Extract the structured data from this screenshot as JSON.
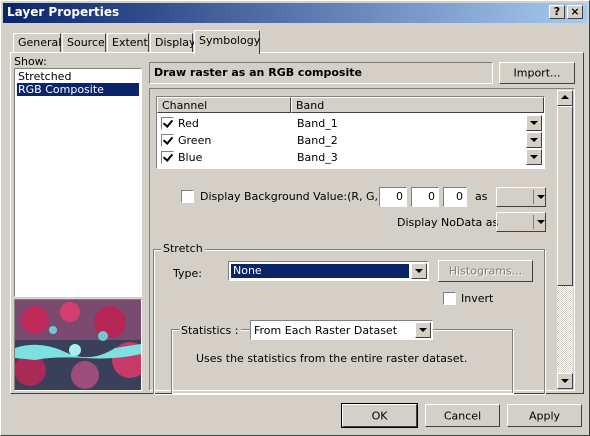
{
  "window": {
    "title": "Layer Properties",
    "help_label": "?",
    "close_label": "×"
  },
  "tabs": [
    {
      "label": "General"
    },
    {
      "label": "Source"
    },
    {
      "label": "Extent"
    },
    {
      "label": "Display"
    },
    {
      "label": "Symbology"
    }
  ],
  "show": {
    "label": "Show:",
    "items": [
      {
        "label": "Stretched"
      },
      {
        "label": "RGB Composite"
      }
    ],
    "selected_index": 1
  },
  "header": {
    "title": "Draw raster as an RGB composite",
    "import_label": "Import..."
  },
  "channel_table": {
    "col_channel": "Channel",
    "col_band": "Band",
    "rows": [
      {
        "channel": "Red",
        "band": "Band_1",
        "checked": true
      },
      {
        "channel": "Green",
        "band": "Band_2",
        "checked": true
      },
      {
        "channel": "Blue",
        "band": "Band_3",
        "checked": true
      }
    ]
  },
  "background": {
    "label": "Display Background Value:(R, G, B)",
    "r": "0",
    "g": "0",
    "b": "0",
    "as_label": "as",
    "nodata_label": "Display NoData as"
  },
  "stretch": {
    "group_label": "Stretch",
    "type_label": "Type:",
    "type_value": "None",
    "histograms_label": "Histograms...",
    "invert_label": "Invert",
    "statistics_label": "Statistics :",
    "statistics_value": "From Each Raster Dataset",
    "statistics_desc": "Uses the statistics from the entire raster dataset."
  },
  "footer": {
    "ok_label": "OK",
    "cancel_label": "Cancel",
    "apply_label": "Apply"
  },
  "colors": {
    "title_start": "#0a246a",
    "title_end": "#a6caf0",
    "selection": "#0a246a",
    "face": "#d4d0c8"
  }
}
